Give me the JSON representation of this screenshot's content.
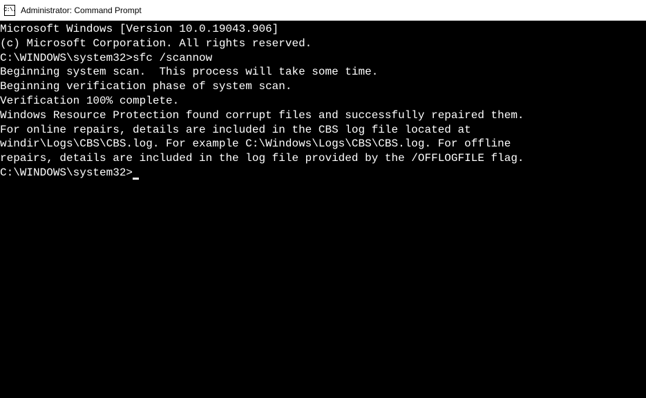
{
  "window": {
    "title": "Administrator: Command Prompt",
    "icon_label": "C:\\."
  },
  "terminal": {
    "lines": [
      "Microsoft Windows [Version 10.0.19043.906]",
      "(c) Microsoft Corporation. All rights reserved.",
      "",
      "C:\\WINDOWS\\system32>sfc /scannow",
      "",
      "Beginning system scan.  This process will take some time.",
      "",
      "Beginning verification phase of system scan.",
      "Verification 100% complete.",
      "",
      "Windows Resource Protection found corrupt files and successfully repaired them.",
      "For online repairs, details are included in the CBS log file located at",
      "windir\\Logs\\CBS\\CBS.log. For example C:\\Windows\\Logs\\CBS\\CBS.log. For offline",
      "repairs, details are included in the log file provided by the /OFFLOGFILE flag.",
      ""
    ],
    "current_prompt": "C:\\WINDOWS\\system32>"
  }
}
